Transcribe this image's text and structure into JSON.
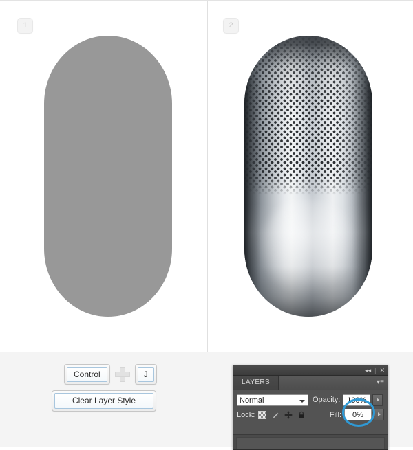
{
  "steps": [
    {
      "badge": "1",
      "name": "flat-silhouette"
    },
    {
      "badge": "2",
      "name": "metallic-speaker"
    }
  ],
  "shortcut": {
    "key1_label": "Control",
    "plus_icon": "plus-icon",
    "key2_label": "J"
  },
  "action_button": {
    "label": "Clear Layer Style"
  },
  "layers_panel": {
    "titlebar": {
      "collapse_icon": "◂◂",
      "separator": "|",
      "close_icon": "✕"
    },
    "tab_label": "LAYERS",
    "menu_icon": "▾≡",
    "blend_mode": {
      "value": "Normal",
      "caret_icon": "chevron-down-icon"
    },
    "opacity": {
      "label": "Opacity:",
      "value": "100%",
      "stepper_icon": "▸"
    },
    "lock": {
      "label": "Lock:",
      "icons": [
        {
          "name": "lock-transparent-pixels-icon",
          "glyph": ""
        },
        {
          "name": "lock-image-pixels-brush-icon",
          "glyph": "╱"
        },
        {
          "name": "lock-position-move-icon",
          "glyph": "✤"
        },
        {
          "name": "lock-all-padlock-icon",
          "glyph": "🔒"
        }
      ]
    },
    "fill": {
      "label": "Fill:",
      "value": "0%",
      "stepper_icon": "▸",
      "highlight_color": "#2f9ad6"
    }
  },
  "colors": {
    "flat_shape": "#989898",
    "bottom_bar": "#f4f4f4",
    "panel_bg": "#535353",
    "highlight_ring": "#2f9ad6"
  }
}
